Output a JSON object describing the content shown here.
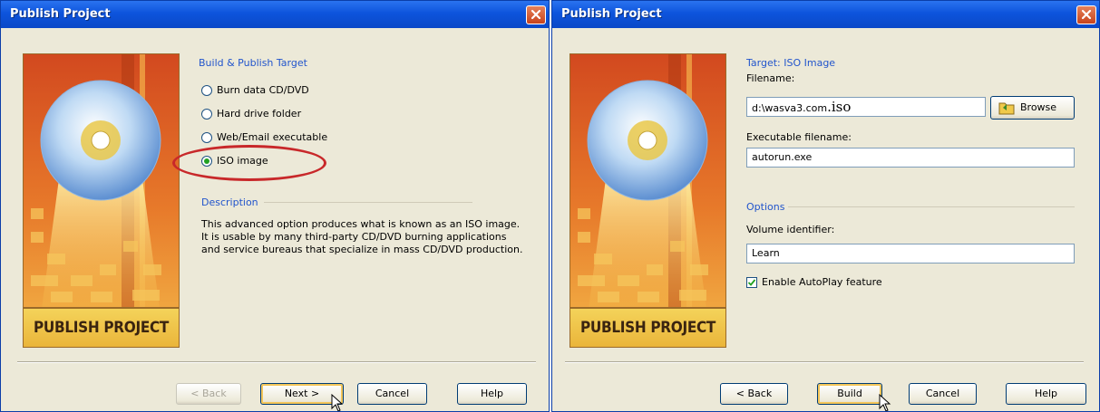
{
  "dialog1": {
    "title": "Publish Project",
    "banner": "PUBLISH PROJECT",
    "section_target": "Build & Publish Target",
    "options": [
      "Burn data CD/DVD",
      "Hard drive folder",
      "Web/Email executable",
      "ISO image"
    ],
    "selected_option": "ISO image",
    "section_description": "Description",
    "description": "This advanced option produces what is known as an ISO image. It is usable by many third-party CD/DVD burning applications and service bureaus that specialize in mass CD/DVD production.",
    "buttons": {
      "back": "< Back",
      "next": "Next >",
      "cancel": "Cancel",
      "help": "Help"
    }
  },
  "dialog2": {
    "title": "Publish Project",
    "banner": "PUBLISH PROJECT",
    "section_target": "Target: ISO Image",
    "filename_label": "Filename:",
    "filename_value": "d:\\wasva3.com",
    "filename_ext": ".iso",
    "browse_label": "Browse",
    "exe_label": "Executable filename:",
    "exe_value": "autorun.exe",
    "section_options": "Options",
    "volume_label": "Volume identifier:",
    "volume_value": "Learn",
    "autoplay_label": "Enable AutoPlay feature",
    "autoplay_checked": true,
    "buttons": {
      "back": "< Back",
      "build": "Build",
      "cancel": "Cancel",
      "help": "Help"
    }
  },
  "colors": {
    "titlebar": "#0d54dc",
    "dialog_bg": "#ece9d8",
    "highlight_oval": "#c8282a",
    "section_text": "#2255cc"
  }
}
